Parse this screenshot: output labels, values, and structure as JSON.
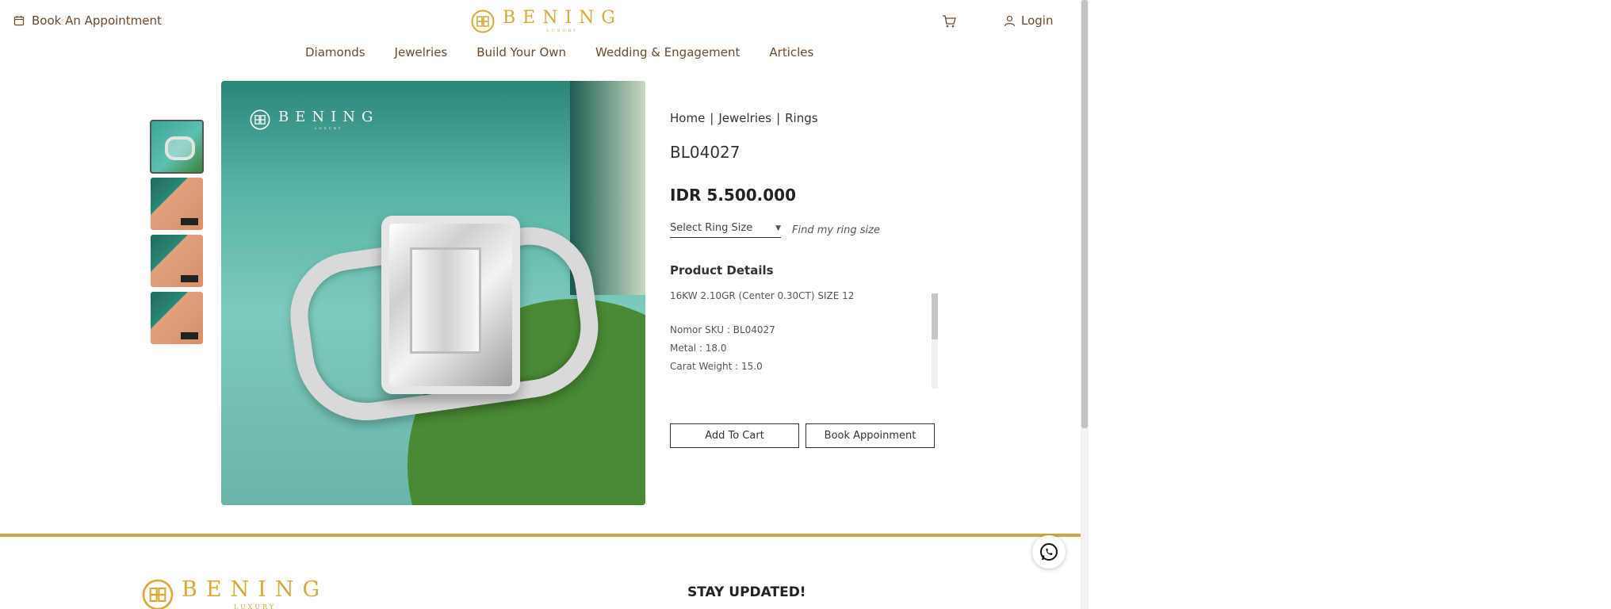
{
  "header": {
    "book_appointment": "Book An Appointment",
    "brand_name": "BENING",
    "brand_sub": "LUXURY",
    "login": "Login"
  },
  "nav": [
    "Diamonds",
    "Jewelries",
    "Build Your Own",
    "Wedding & Engagement",
    "Articles"
  ],
  "breadcrumb": [
    "Home",
    "Jewelries",
    "Rings"
  ],
  "breadcrumb_sep": "|",
  "product": {
    "sku": "BL04027",
    "price": "IDR 5.500.000",
    "ring_size_placeholder": "Select Ring Size",
    "find_size": "Find my ring size",
    "details_title": "Product Details",
    "details": [
      "16KW 2.10GR (Center 0.30CT) SIZE 12",
      "Nomor SKU : BL04027",
      "Metal : 18.0",
      "Carat Weight : 15.0"
    ],
    "add_to_cart": "Add To Cart",
    "book_appointment": "Book Appoinment"
  },
  "footer": {
    "stay_updated": "STAY UPDATED!"
  },
  "colors": {
    "gold": "#d6a53a",
    "brown_text": "#6b4a2e",
    "teal": "#57b3a4"
  },
  "icons": [
    "calendar-icon",
    "cart-icon",
    "user-icon",
    "whatsapp-icon",
    "chevron-down-icon"
  ]
}
